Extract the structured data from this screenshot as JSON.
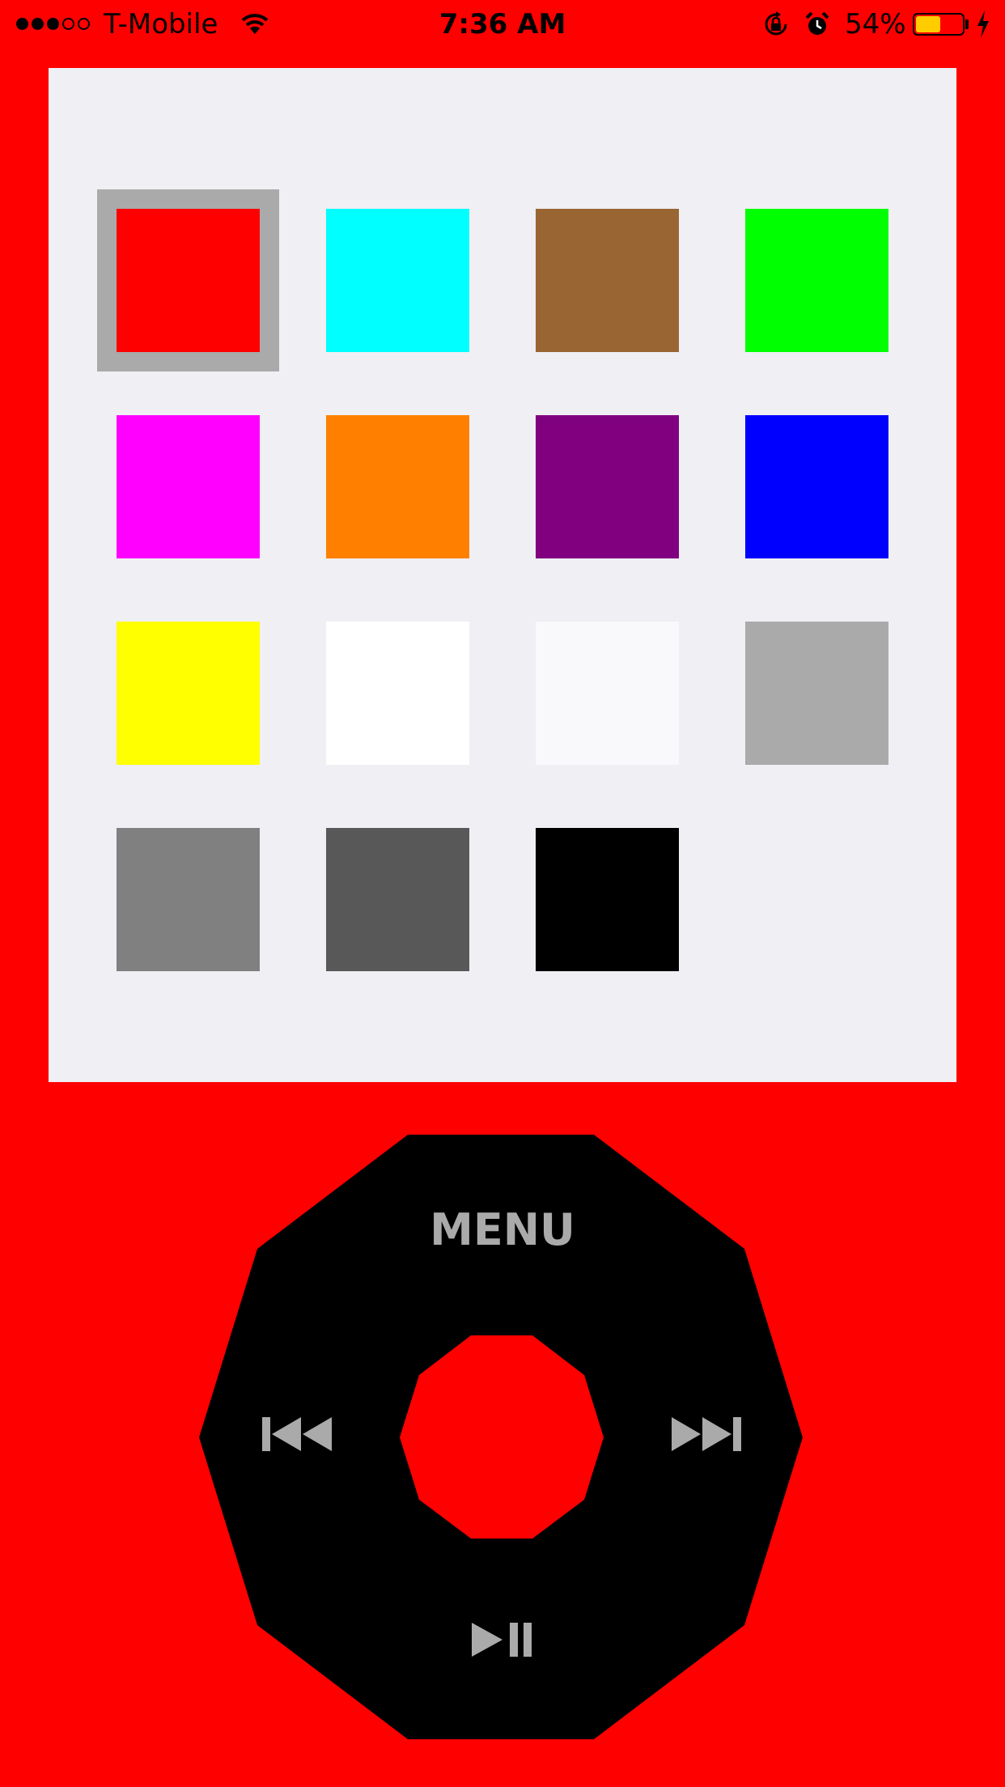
{
  "status_bar": {
    "signal_bars": [
      true,
      true,
      true,
      false,
      false
    ],
    "carrier": "T-Mobile",
    "time": "7:36 AM",
    "battery_percent_label": "54%",
    "battery_level": 0.54,
    "icons": [
      "wifi-icon",
      "rotation-lock-icon",
      "alarm-icon",
      "battery-icon",
      "charging-icon"
    ]
  },
  "colors": {
    "background": "#ff0000",
    "panel": "#efeff4",
    "selection_ring": "#aaaaaa",
    "wheel": "#000000",
    "center_button": "#ff0000",
    "wheel_controls": "#aaaaaa",
    "battery_fill": "#ffcc00"
  },
  "swatches": [
    {
      "name": "red",
      "color": "#ff0000",
      "selected": true
    },
    {
      "name": "cyan",
      "color": "#00ffff",
      "selected": false
    },
    {
      "name": "brown",
      "color": "#996633",
      "selected": false
    },
    {
      "name": "green",
      "color": "#00ff00",
      "selected": false
    },
    {
      "name": "magenta",
      "color": "#ff00ff",
      "selected": false
    },
    {
      "name": "orange",
      "color": "#ff8000",
      "selected": false
    },
    {
      "name": "purple",
      "color": "#800080",
      "selected": false
    },
    {
      "name": "blue",
      "color": "#0000ff",
      "selected": false
    },
    {
      "name": "yellow",
      "color": "#ffff00",
      "selected": false
    },
    {
      "name": "white",
      "color": "#ffffff",
      "selected": false
    },
    {
      "name": "off-white",
      "color": "#f9f9fb",
      "selected": false
    },
    {
      "name": "light-gray",
      "color": "#aaaaaa",
      "selected": false
    },
    {
      "name": "gray",
      "color": "#808080",
      "selected": false
    },
    {
      "name": "dark-gray",
      "color": "#585858",
      "selected": false
    },
    {
      "name": "black",
      "color": "#000000",
      "selected": false
    }
  ],
  "wheel": {
    "menu_label": "MENU",
    "controls": [
      "previous-track-icon",
      "next-track-icon",
      "play-pause-icon"
    ]
  }
}
